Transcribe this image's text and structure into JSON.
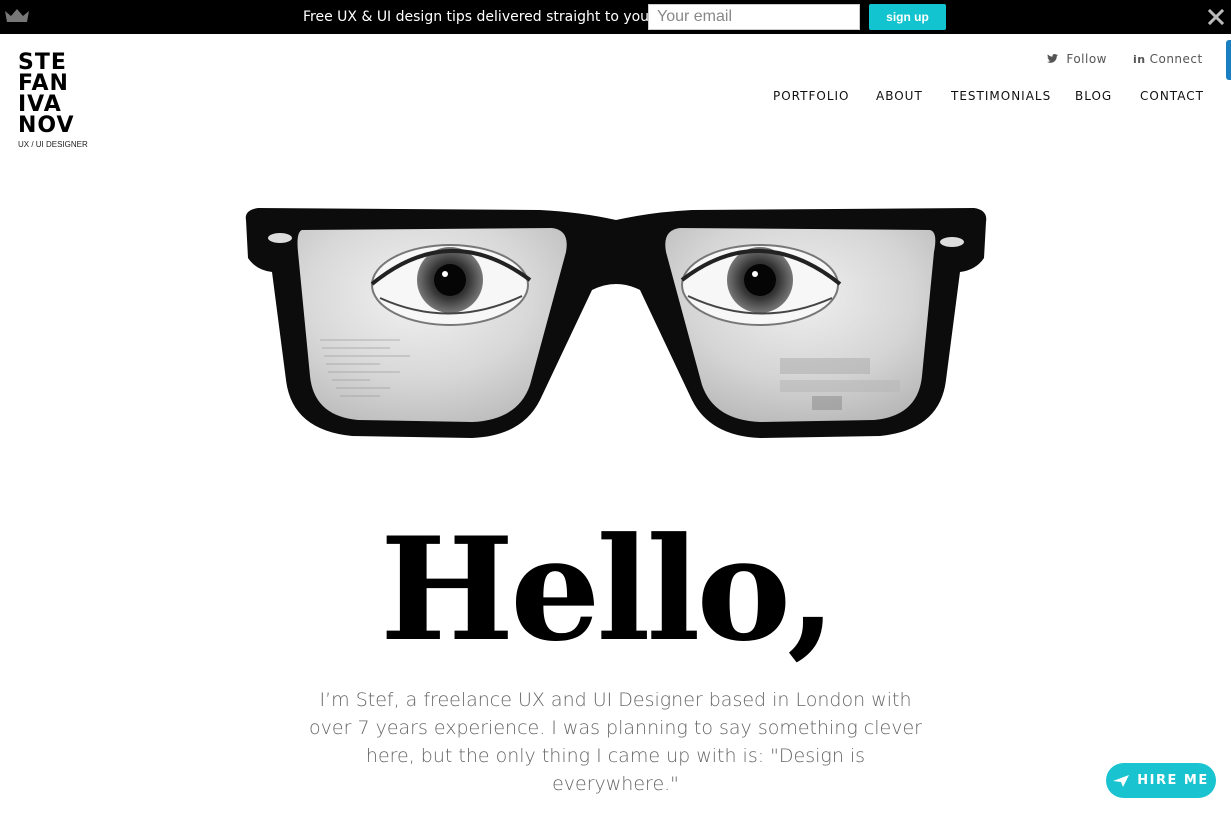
{
  "promo": {
    "text": "Free UX & UI design tips delivered straight to your inbox",
    "email_placeholder": "Your email",
    "signup_label": "sign up"
  },
  "logo": {
    "lines": [
      "STE",
      "FAN",
      "IVA",
      "NOV"
    ],
    "tagline": "UX / UI DESIGNER"
  },
  "social": {
    "follow": "Follow",
    "connect": "Connect"
  },
  "nav": {
    "items": [
      "PORTFOLIO",
      "ABOUT",
      "TESTIMONIALS",
      "BLOG",
      "CONTACT"
    ]
  },
  "hero": {
    "heading": "Hello,",
    "intro": "I’m Stef, a freelance UX and UI Designer based in London with over 7 years experience. I was planning to say something clever here, but the only thing I came up with is: \"Design is everywhere.\""
  },
  "hire": {
    "label": "HIRE ME"
  },
  "colors": {
    "accent": "#12c4cf",
    "topbar": "#000000",
    "text_muted": "#666666"
  }
}
